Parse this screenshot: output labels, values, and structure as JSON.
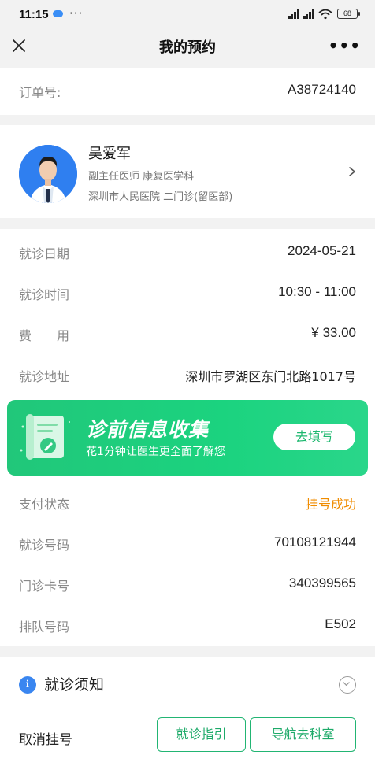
{
  "status_bar": {
    "time": "11:15",
    "dots": "···",
    "battery": "68"
  },
  "nav": {
    "title": "我的预约",
    "more": "•••"
  },
  "order": {
    "label": "订单号:",
    "value": "A38724140"
  },
  "doctor": {
    "name": "吴爱军",
    "title": "副主任医师 康复医学科",
    "hospital": "深圳市人民医院 二门诊(留医部)"
  },
  "visit": {
    "date_label": "就诊日期",
    "date": "2024-05-21",
    "time_label": "就诊时间",
    "time": "10:30 - 11:00",
    "fee_label": "费　　用",
    "fee": "¥ 33.00",
    "address_label": "就诊地址",
    "address": "深圳市罗湖区东门北路1017号"
  },
  "banner": {
    "title": "诊前信息收集",
    "subtitle": "花1分钟让医生更全面了解您",
    "button": "去填写"
  },
  "payment": {
    "status_label": "支付状态",
    "status": "挂号成功",
    "visit_no_label": "就诊号码",
    "visit_no": "70108121944",
    "card_label": "门诊卡号",
    "card": "340399565",
    "queue_label": "排队号码",
    "queue": "E502"
  },
  "notice": {
    "title": "就诊须知",
    "cancel": "取消挂号",
    "guide_button": "就诊指引",
    "nav_button": "导航去科室"
  },
  "colors": {
    "accent_green": "#21c77a",
    "status_orange": "#f08c00",
    "info_blue": "#3a86f0"
  }
}
